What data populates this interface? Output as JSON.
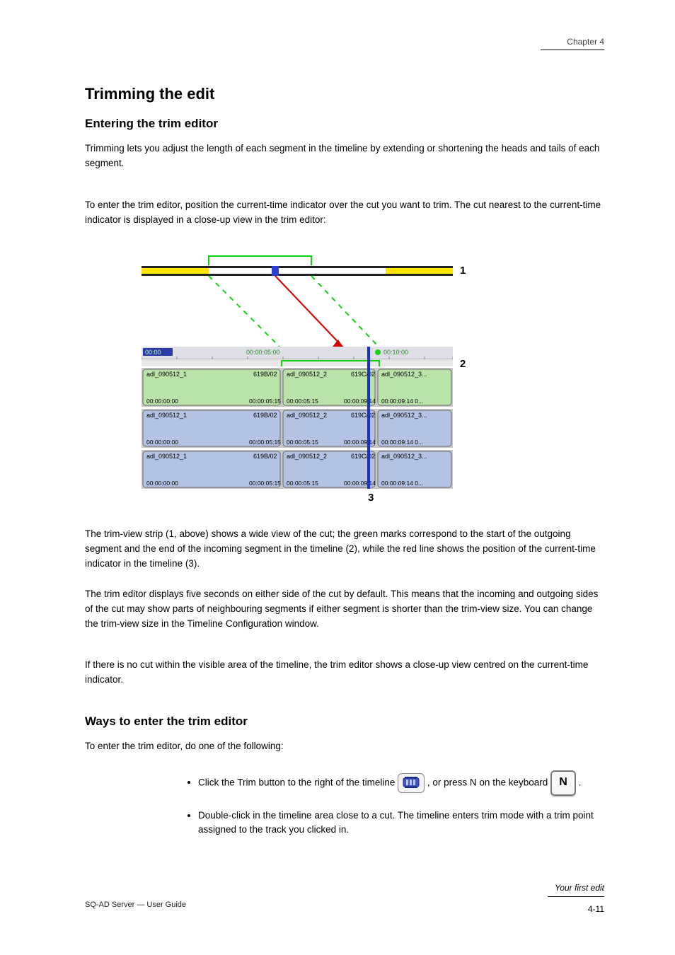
{
  "header": {
    "chapterLabel": "Chapter 4"
  },
  "titles": {
    "main": "Trimming the edit",
    "sub1": "Entering the trim editor",
    "sub2": "Ways to enter the trim editor"
  },
  "body": {
    "p1": "Trimming lets you adjust the length of each segment in the timeline by extending or shortening the heads and tails of each segment.",
    "p2": "To enter the trim editor, position the current-time indicator over the cut you want to trim. The cut nearest to the current-time indicator is displayed in a close-up view in the trim editor:",
    "p3": "The trim-view strip (1, above) shows a wide view of the cut; the green marks correspond to the start of the outgoing segment and the end of the incoming segment in the timeline (2), while the red line shows the position of the current-time indicator in the timeline (3).",
    "p4": "The trim editor displays five seconds on either side of the cut by default. This means that the incoming and outgoing sides of the cut may show parts of neighbouring segments if either segment is shorter than the trim-view size. You can change the trim-view size in the Timeline Configuration window.",
    "p5": "If there is no cut within the visible area of the timeline, the trim editor shows a close-up view centred on the current-time indicator.",
    "p6": "To enter the trim editor, do one of the following:"
  },
  "bullets": {
    "b1_pre": "Click the Trim button to the right of the timeline ",
    "b1_post": ", or press N on the keyboard ",
    "b1_tail": ".",
    "b2": "Double-click in the timeline area close to a cut. The timeline enters trim mode with a trim point assigned to the track you clicked in."
  },
  "key": {
    "N": "N"
  },
  "diagram": {
    "markers": {
      "one": "1",
      "two": "2",
      "three": "3"
    },
    "ruler": {
      "t0": "00:00",
      "t1": "00:00:05:00",
      "t2": "00:10:00"
    },
    "clips": {
      "name1": "adl_090512_1",
      "code1": "619B/02",
      "name2": "adl_090512_2",
      "code2": "619C/02",
      "name3": "adl_090512_3...",
      "tc_a": "00:00:00:00",
      "tc_b": "00:00:05:15",
      "tc_c": "00:00:05:15",
      "tc_d": "00:00:09:14",
      "tc_e": "00:00:09:14 0..."
    }
  },
  "footer": {
    "left": "SQ-AD Server — User Guide",
    "rightTitle": "Your first edit",
    "page": "4-11"
  }
}
